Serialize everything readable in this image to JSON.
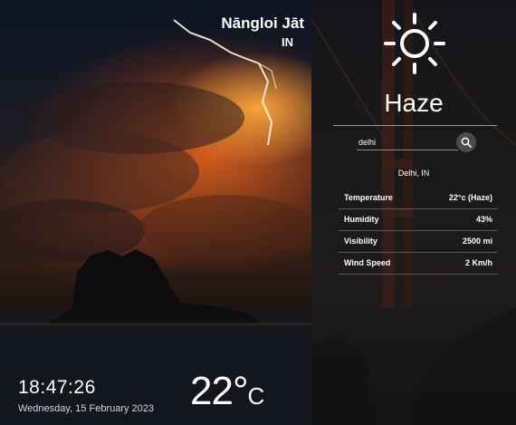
{
  "location": {
    "city": "Nāngloi Jāt",
    "country": "IN"
  },
  "clock": {
    "time": "18:47:26",
    "date": "Wednesday, 15 February 2023"
  },
  "current": {
    "temperature": "22°",
    "unit": "C"
  },
  "panel": {
    "icon": "sun-icon",
    "condition": "Haze",
    "search": {
      "value": "delhi",
      "icon": "search-icon"
    },
    "place": "Delhi, IN",
    "rows": [
      {
        "label": "Temperature",
        "value": "22°c (Haze)"
      },
      {
        "label": "Humidity",
        "value": "43%"
      },
      {
        "label": "Visibility",
        "value": "2500 mi"
      },
      {
        "label": "Wind Speed",
        "value": "2 Km/h"
      }
    ]
  },
  "colors": {
    "accent": "#ffffff",
    "storm_glow": "#e8661c",
    "panel_bg": "#1e1e22"
  }
}
